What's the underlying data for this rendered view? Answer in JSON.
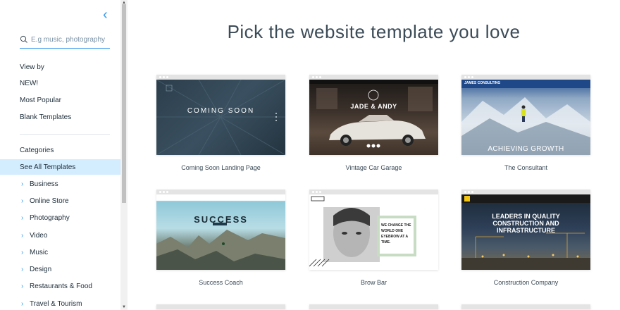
{
  "sidebar": {
    "search_placeholder": "E.g music, photography",
    "view_by_title": "View by",
    "view_items": [
      "NEW!",
      "Most Popular",
      "Blank Templates"
    ],
    "categories_title": "Categories",
    "see_all": "See All Templates",
    "categories": [
      "Business",
      "Online Store",
      "Photography",
      "Video",
      "Music",
      "Design",
      "Restaurants & Food",
      "Travel & Tourism"
    ]
  },
  "main": {
    "title": "Pick the website template you love",
    "templates": [
      {
        "name": "Coming Soon Landing Page",
        "headline": "COMING SOON"
      },
      {
        "name": "Vintage Car Garage",
        "headline": "JADE & ANDY"
      },
      {
        "name": "The Consultant",
        "headline": "ACHIEVING GROWTH",
        "brand": "JAMES CONSULTING"
      },
      {
        "name": "Success Coach",
        "headline": "SUCCESS"
      },
      {
        "name": "Brow Bar",
        "headline": "WE CHANGE THE WORLD ONE EYEBROW AT A TIME."
      },
      {
        "name": "Construction Company",
        "headline": "LEADERS IN QUALITY CONSTRUCTION AND INFRASTRUCTURE"
      }
    ]
  },
  "colors": {
    "accent": "#3899ec",
    "active_bg": "#d3edff",
    "title": "#3b4b57"
  }
}
